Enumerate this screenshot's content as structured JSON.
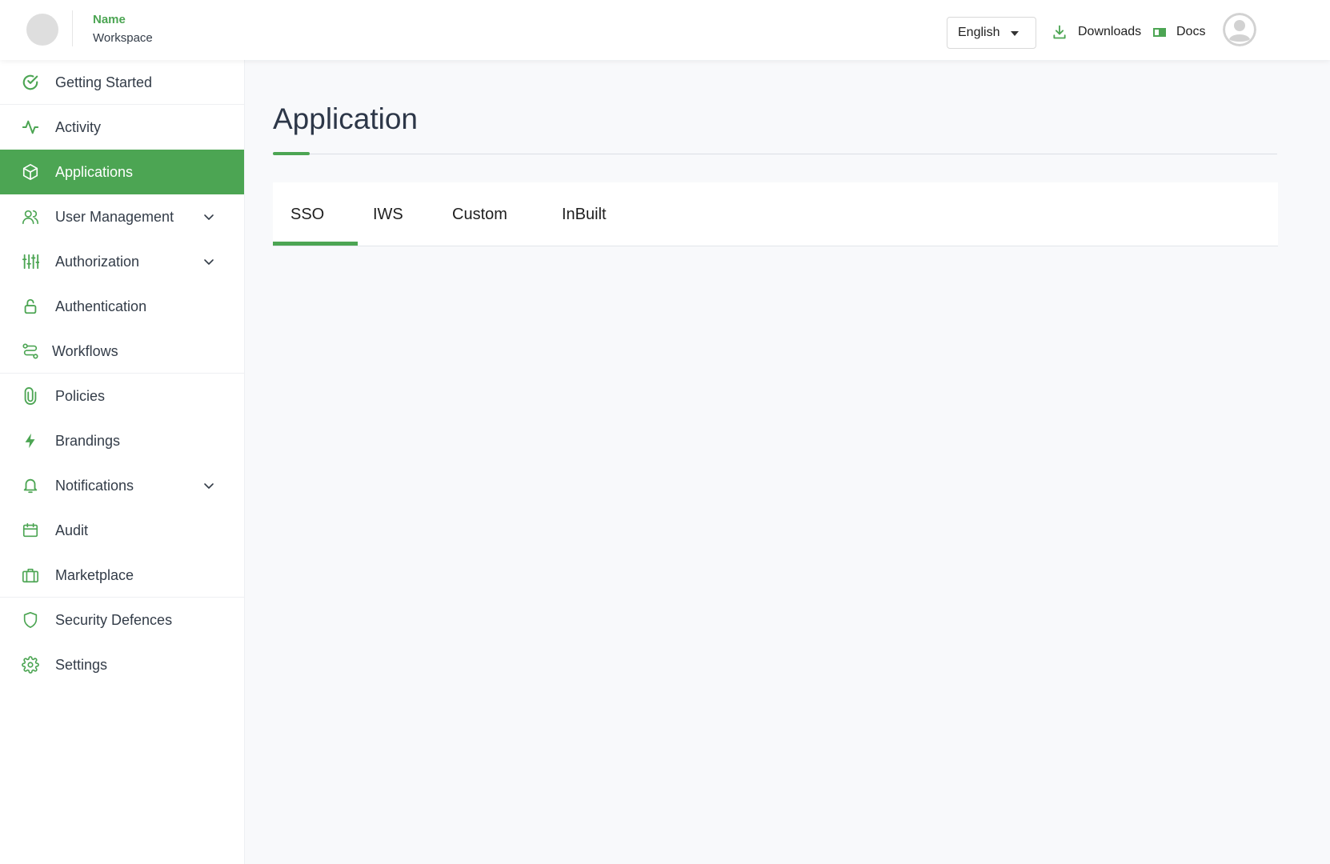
{
  "header": {
    "brand_name": "Name",
    "brand_subtitle": "Workspace",
    "language": {
      "selected": "English"
    },
    "downloads_label": "Downloads",
    "docs_label": "Docs"
  },
  "sidebar": {
    "items": [
      {
        "label": "Getting Started",
        "icon": "check-circle-icon",
        "active": false
      },
      {
        "label": "Activity",
        "icon": "activity-icon",
        "active": false
      },
      {
        "label": "Applications",
        "icon": "box-icon",
        "active": true
      },
      {
        "label": "User Management",
        "icon": "users-icon",
        "active": false,
        "expandable": true
      },
      {
        "label": "Authorization",
        "icon": "sliders-icon",
        "active": false,
        "expandable": true
      },
      {
        "label": "Authentication",
        "icon": "lock-icon",
        "active": false
      },
      {
        "label": "Workflows",
        "icon": "workflow-icon",
        "active": false
      },
      {
        "label": "Policies",
        "icon": "paperclip-icon",
        "active": false
      },
      {
        "label": "Brandings",
        "icon": "lightning-icon",
        "active": false
      },
      {
        "label": "Notifications",
        "icon": "bell-icon",
        "active": false,
        "expandable": true
      },
      {
        "label": "Audit",
        "icon": "calendar-icon",
        "active": false
      },
      {
        "label": "Marketplace",
        "icon": "briefcase-icon",
        "active": false
      },
      {
        "label": "Security Defences",
        "icon": "shield-icon",
        "active": false
      },
      {
        "label": "Settings",
        "icon": "gear-icon",
        "active": false
      }
    ]
  },
  "main": {
    "title": "Application",
    "tabs": [
      {
        "label": "SSO",
        "active": true
      },
      {
        "label": "IWS",
        "active": false
      },
      {
        "label": "Custom",
        "active": false
      },
      {
        "label": "InBuilt",
        "active": false
      }
    ]
  },
  "colors": {
    "accent": "#4ca553",
    "text": "#333c48",
    "background": "#f8f9fb"
  }
}
